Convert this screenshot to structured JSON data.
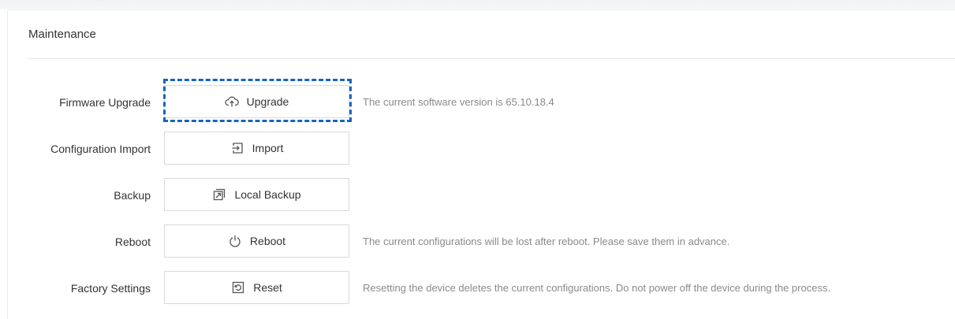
{
  "panel": {
    "title": "Maintenance"
  },
  "rows": [
    {
      "label": "Firmware Upgrade",
      "button_label": "Upgrade",
      "button_icon": "cloud-upload-icon",
      "hint": "The current software version is 65.10.18.4"
    },
    {
      "label": "Configuration Import",
      "button_label": "Import",
      "button_icon": "import-icon",
      "hint": ""
    },
    {
      "label": "Backup",
      "button_label": "Local Backup",
      "button_icon": "backup-icon",
      "hint": ""
    },
    {
      "label": "Reboot",
      "button_label": "Reboot",
      "button_icon": "power-icon",
      "hint": "The current configurations will be lost after reboot. Please save them in advance."
    },
    {
      "label": "Factory Settings",
      "button_label": "Reset",
      "button_icon": "reset-icon",
      "hint": "Resetting the device deletes the current configurations. Do not power off the device during the process."
    }
  ],
  "colors": {
    "highlight_border": "#1565c0",
    "text": "#333333",
    "hint_text": "#8a8a8a",
    "button_border": "#d9d9d9"
  }
}
